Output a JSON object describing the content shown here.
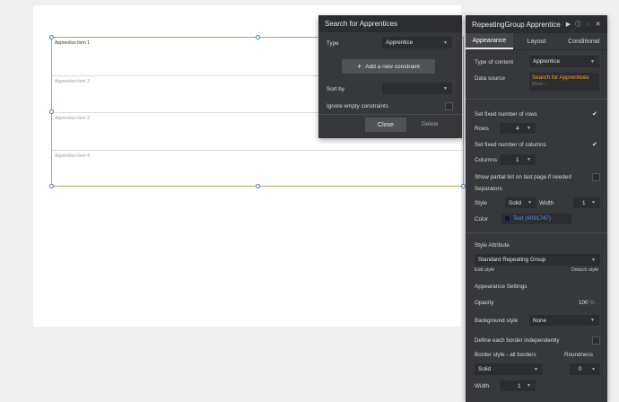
{
  "canvas": {
    "items": [
      "Apprentice item 1",
      "Apprentice item 2",
      "Apprentice item 3",
      "Apprentice item 4"
    ]
  },
  "search": {
    "title": "Search for Apprentices",
    "type_label": "Type",
    "type_value": "Apprentice",
    "add_constraint": "Add a new constraint",
    "sort_label": "Sort by",
    "sort_value": "",
    "ignore_label": "Ignore empty constraints",
    "close": "Close",
    "delete": "Delete"
  },
  "props": {
    "title": "RepeatingGroup Apprentice",
    "tabs": [
      "Appearance",
      "Layout",
      "Conditional"
    ],
    "type_of_content_label": "Type of content",
    "type_of_content_value": "Apprentice",
    "data_source_label": "Data source",
    "data_source_value": "Search for Apprentices",
    "data_source_more": "More...",
    "fixed_rows_label": "Set fixed number of rows",
    "rows_label": "Rows",
    "rows_value": "4",
    "fixed_cols_label": "Set fixed number of columns",
    "cols_label": "Columns",
    "cols_value": "1",
    "partial_label": "Show partial list on last page if needed",
    "separators_label": "Separators",
    "sep_style_label": "Style",
    "sep_style_value": "Solid",
    "sep_width_label": "Width",
    "sep_width_value": "1",
    "sep_color_label": "Color",
    "sep_color_value": "Text (#091747)",
    "style_attr_label": "Style Attribute",
    "style_attr_value": "Standard Repeating Group",
    "edit_style": "Edit style",
    "detach_style": "Detach style",
    "appearance_settings": "Appearance Settings",
    "opacity_label": "Opacity",
    "opacity_value": "100",
    "opacity_unit": "%",
    "bg_style_label": "Background style",
    "bg_style_value": "None",
    "define_border_label": "Define each border independently",
    "border_style_label": "Border style - all borders",
    "roundness_label": "Roundness",
    "border_style_value": "Solid",
    "roundness_value": "0",
    "width_label": "Width",
    "width_value": "1"
  },
  "colors": {
    "separator_color": "#091747",
    "accent_link": "#f5a623",
    "selection_border": "#b5a94a"
  }
}
